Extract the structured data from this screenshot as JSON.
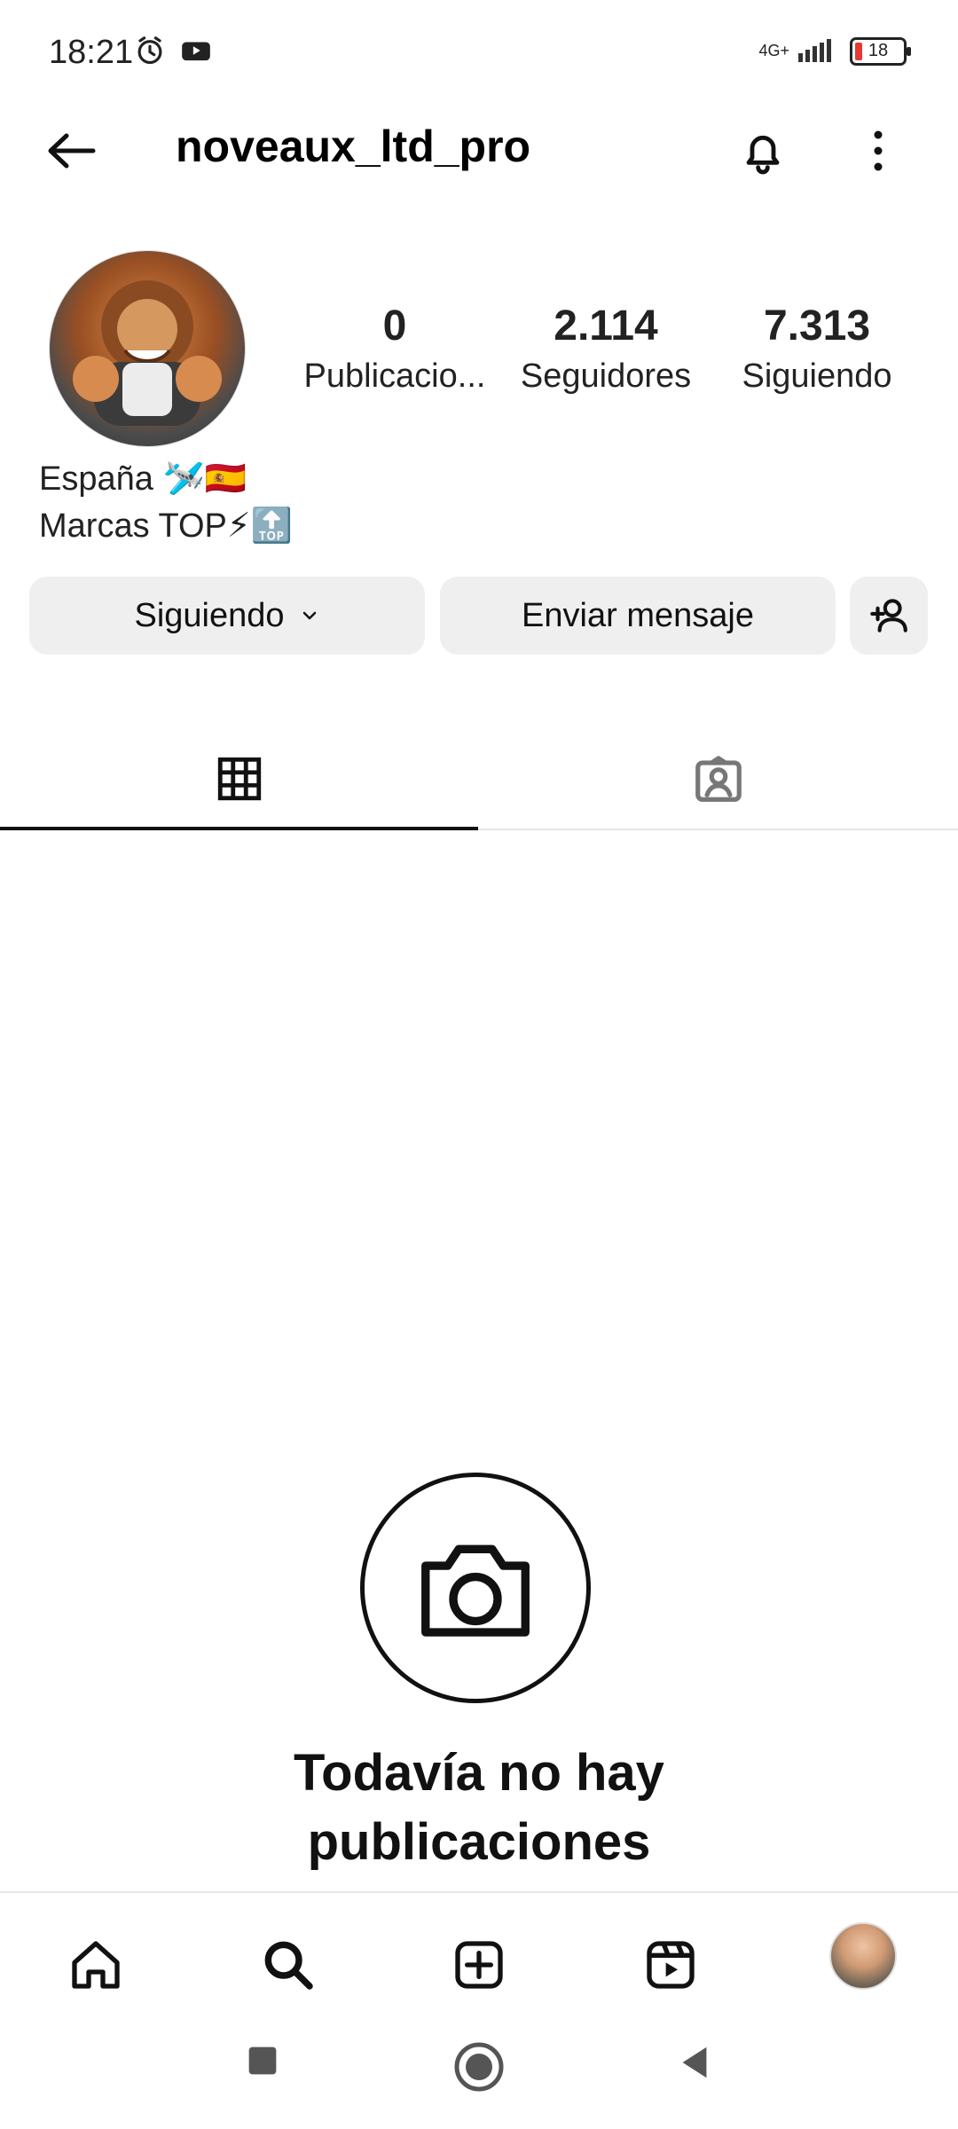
{
  "status": {
    "time": "18:21",
    "network": "4G+",
    "battery": "18"
  },
  "header": {
    "username": "noveaux_ltd_pro"
  },
  "profile": {
    "stats": [
      {
        "value": "0",
        "label": "Publicacio..."
      },
      {
        "value": "2.114",
        "label": "Seguidores"
      },
      {
        "value": "7.313",
        "label": "Siguiendo"
      }
    ],
    "bio": [
      "España 🛩️🇪🇸",
      "Marcas TOP⚡🔝"
    ]
  },
  "actions": {
    "following": "Siguiendo",
    "message": "Enviar mensaje"
  },
  "empty": {
    "line1": "Todavía no hay",
    "line2": "publicaciones"
  },
  "icons": {
    "back": "arrow-left",
    "bell": "bell",
    "more": "vertical-dots",
    "grid": "grid",
    "tagged": "user-tag",
    "camera": "camera",
    "home": "home",
    "search": "search",
    "create": "plus-square",
    "reels": "reels",
    "add_user": "add-user"
  }
}
